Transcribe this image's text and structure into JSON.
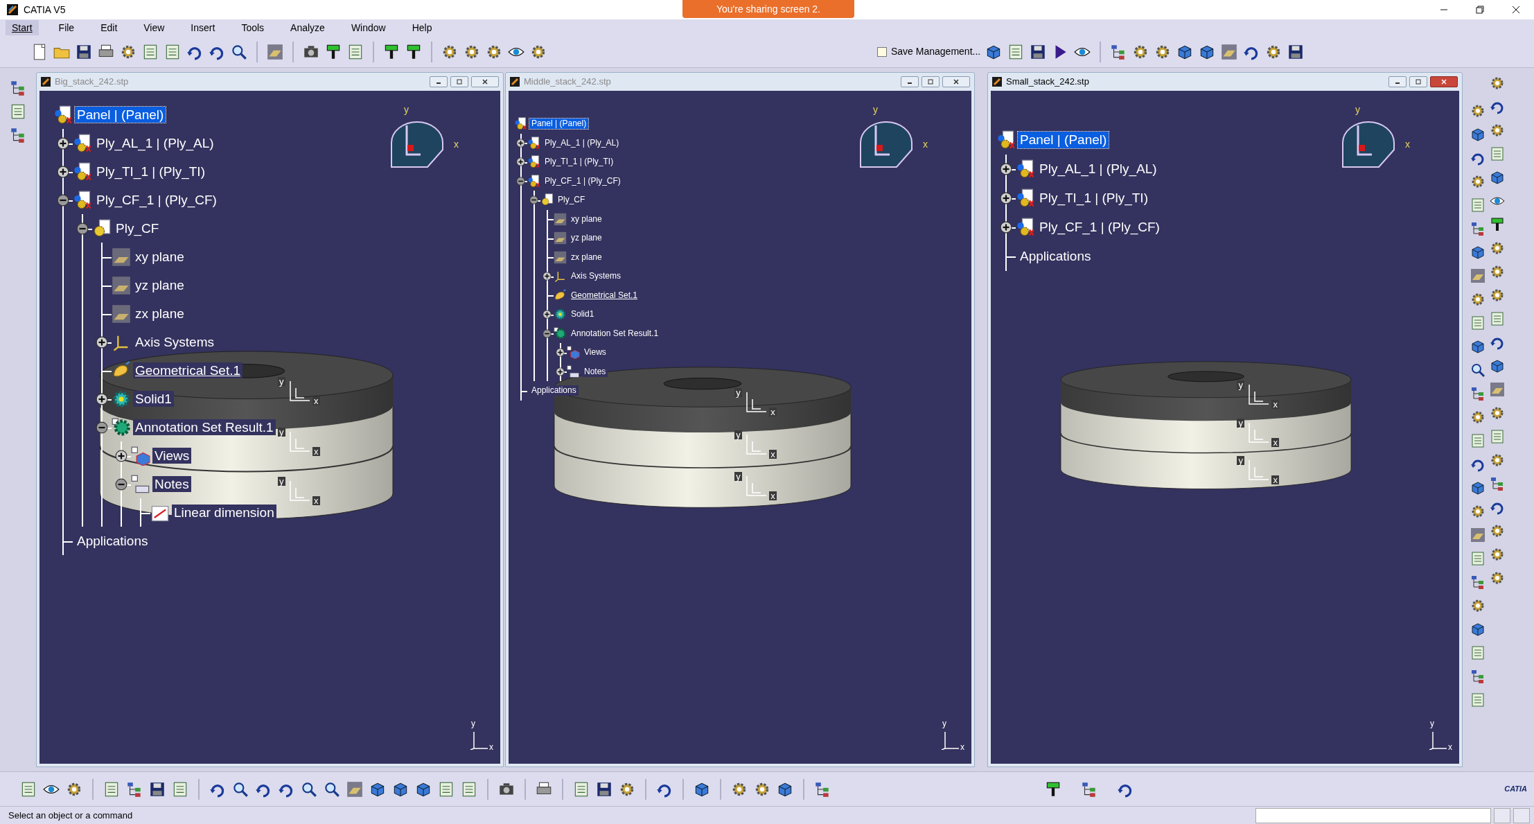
{
  "app": {
    "title": "CATIA V5",
    "sharing_banner": "You're sharing screen 2."
  },
  "menu": [
    {
      "label": "Start",
      "selected": true
    },
    {
      "label": "File",
      "selected": false
    },
    {
      "label": "Edit",
      "selected": false
    },
    {
      "label": "View",
      "selected": false
    },
    {
      "label": "Insert",
      "selected": false
    },
    {
      "label": "Tools",
      "selected": false
    },
    {
      "label": "Analyze",
      "selected": false
    },
    {
      "label": "Window",
      "selected": false
    },
    {
      "label": "Help",
      "selected": false
    }
  ],
  "toolbar": {
    "save_management": {
      "label": "Save Management...",
      "checked": false
    }
  },
  "windows": [
    {
      "title": "Big_stack_242.stp",
      "active": false,
      "compass_labels": [
        "y",
        "x"
      ],
      "corner_axis_labels": [
        "y",
        "x"
      ],
      "model_axis_labels": [
        [
          "y",
          "x"
        ],
        [
          "y",
          "x"
        ],
        [
          "y",
          "x"
        ]
      ],
      "tree": [
        {
          "label": "Panel | (Panel)",
          "kind": "product",
          "selected": true,
          "current": false,
          "children": [
            {
              "label": "Ply_AL_1 | (Ply_AL)",
              "kind": "product",
              "expanded": false,
              "selected": false,
              "current": false
            },
            {
              "label": "Ply_TI_1 | (Ply_TI)",
              "kind": "product",
              "expanded": false,
              "selected": false,
              "current": false
            },
            {
              "label": "Ply_CF_1 | (Ply_CF)",
              "kind": "product",
              "expanded": true,
              "selected": false,
              "current": false,
              "children": [
                {
                  "label": "Ply_CF",
                  "kind": "part",
                  "expanded": true,
                  "selected": false,
                  "current": false,
                  "children": [
                    {
                      "label": "xy plane",
                      "kind": "plane",
                      "selected": false,
                      "current": false
                    },
                    {
                      "label": "yz plane",
                      "kind": "plane",
                      "selected": false,
                      "current": false
                    },
                    {
                      "label": "zx plane",
                      "kind": "plane",
                      "selected": false,
                      "current": false
                    },
                    {
                      "label": "Axis Systems",
                      "kind": "axis",
                      "expanded": false,
                      "selected": false,
                      "current": false
                    },
                    {
                      "label": "Geometrical Set.1",
                      "kind": "geoset",
                      "selected": false,
                      "current": true
                    },
                    {
                      "label": "Solid1",
                      "kind": "body",
                      "expanded": false,
                      "selected": false,
                      "current": false
                    },
                    {
                      "label": "Annotation Set Result.1",
                      "kind": "annotation",
                      "expanded": true,
                      "selected": false,
                      "current": false,
                      "children": [
                        {
                          "label": "Views",
                          "kind": "views",
                          "expanded": false,
                          "selected": false,
                          "current": false
                        },
                        {
                          "label": "Notes",
                          "kind": "notes",
                          "expanded": true,
                          "selected": false,
                          "current": false,
                          "children": [
                            {
                              "label": "Linear dimension",
                              "kind": "dimension",
                              "selected": false,
                              "current": false
                            }
                          ]
                        }
                      ]
                    }
                  ]
                }
              ]
            },
            {
              "label": "Applications",
              "kind": "applications",
              "selected": false,
              "current": false
            }
          ]
        }
      ]
    },
    {
      "title": "Middle_stack_242.stp",
      "active": false,
      "compass_labels": [
        "y",
        "x"
      ],
      "corner_axis_labels": [
        "y",
        "x"
      ],
      "model_axis_labels": [
        [
          "y",
          "x"
        ],
        [
          "y",
          "x"
        ],
        [
          "y",
          "x"
        ]
      ],
      "tree": [
        {
          "label": "Panel | (Panel)",
          "kind": "product",
          "selected": true,
          "current": false,
          "children": [
            {
              "label": "Ply_AL_1 | (Ply_AL)",
              "kind": "product",
              "expanded": false,
              "selected": false,
              "current": false
            },
            {
              "label": "Ply_TI_1 | (Ply_TI)",
              "kind": "product",
              "expanded": false,
              "selected": false,
              "current": false
            },
            {
              "label": "Ply_CF_1 | (Ply_CF)",
              "kind": "product",
              "expanded": true,
              "selected": false,
              "current": false,
              "children": [
                {
                  "label": "Ply_CF",
                  "kind": "part",
                  "expanded": true,
                  "selected": false,
                  "current": false,
                  "children": [
                    {
                      "label": "xy plane",
                      "kind": "plane",
                      "selected": false,
                      "current": false
                    },
                    {
                      "label": "yz plane",
                      "kind": "plane",
                      "selected": false,
                      "current": false
                    },
                    {
                      "label": "zx plane",
                      "kind": "plane",
                      "selected": false,
                      "current": false
                    },
                    {
                      "label": "Axis Systems",
                      "kind": "axis",
                      "expanded": false,
                      "selected": false,
                      "current": false
                    },
                    {
                      "label": "Geometrical Set.1",
                      "kind": "geoset",
                      "selected": false,
                      "current": true
                    },
                    {
                      "label": "Solid1",
                      "kind": "body",
                      "expanded": false,
                      "selected": false,
                      "current": false
                    },
                    {
                      "label": "Annotation Set Result.1",
                      "kind": "annotation",
                      "expanded": true,
                      "selected": false,
                      "current": false,
                      "children": [
                        {
                          "label": "Views",
                          "kind": "views",
                          "expanded": false,
                          "selected": false,
                          "current": false
                        },
                        {
                          "label": "Notes",
                          "kind": "notes",
                          "expanded": false,
                          "selected": false,
                          "current": false
                        }
                      ]
                    }
                  ]
                }
              ]
            },
            {
              "label": "Applications",
              "kind": "applications",
              "selected": false,
              "current": false
            }
          ]
        }
      ]
    },
    {
      "title": "Small_stack_242.stp",
      "active": true,
      "compass_labels": [
        "y",
        "x"
      ],
      "corner_axis_labels": [
        "y",
        "x"
      ],
      "model_axis_labels": [
        [
          "y",
          "x"
        ],
        [
          "y",
          "x"
        ],
        [
          "y",
          "x"
        ]
      ],
      "tree": [
        {
          "label": "Panel | (Panel)",
          "kind": "product",
          "selected": true,
          "current": false,
          "children": [
            {
              "label": "Ply_AL_1 | (Ply_AL)",
              "kind": "product",
              "expanded": false,
              "selected": false,
              "current": false
            },
            {
              "label": "Ply_TI_1 | (Ply_TI)",
              "kind": "product",
              "expanded": false,
              "selected": false,
              "current": false
            },
            {
              "label": "Ply_CF_1 | (Ply_CF)",
              "kind": "product",
              "expanded": false,
              "selected": false,
              "current": false
            },
            {
              "label": "Applications",
              "kind": "applications",
              "selected": false,
              "current": false
            }
          ]
        }
      ]
    }
  ],
  "status_bar": {
    "message": "Select an object or a command"
  },
  "brand": "CATIA"
}
